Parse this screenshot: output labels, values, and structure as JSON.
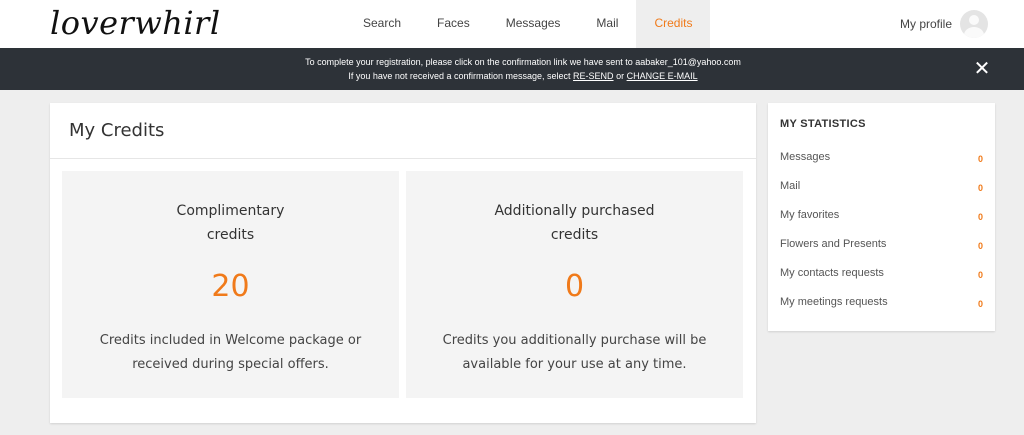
{
  "header": {
    "logo": "loverwhirl",
    "nav": [
      {
        "label": "Search"
      },
      {
        "label": "Faces"
      },
      {
        "label": "Messages"
      },
      {
        "label": "Mail"
      },
      {
        "label": "Credits",
        "active": true
      }
    ],
    "profile_label": "My profile",
    "avatar_icon": "user-avatar-icon"
  },
  "notice": {
    "line1": "To complete your registration, please click on the confirmation link we have sent to aabaker_101@yahoo.com",
    "line2_prefix": "If you have not received a confirmation message, select",
    "resend_link": "RE-SEND",
    "or_text": "or",
    "change_email_link": "CHANGE E-MAIL",
    "close_icon": "close-icon",
    "close_glyph": "✕"
  },
  "credits": {
    "title": "My Credits",
    "complimentary": {
      "heading_line1": "Complimentary",
      "heading_line2": "credits",
      "value": "20",
      "desc_line1": "Credits included in Welcome package or",
      "desc_line2": "received during special offers."
    },
    "purchased": {
      "heading_line1": "Additionally purchased",
      "heading_line2": "credits",
      "value": "0",
      "desc_line1": "Credits you additionally purchase will be",
      "desc_line2": "available for your use at any time."
    }
  },
  "stats": {
    "title": "MY STATISTICS",
    "items": [
      {
        "label": "Messages",
        "count": "0"
      },
      {
        "label": "Mail",
        "count": "0"
      },
      {
        "label": "My favorites",
        "count": "0"
      },
      {
        "label": "Flowers and Presents",
        "count": "0"
      },
      {
        "label": "My contacts requests",
        "count": "0"
      },
      {
        "label": "My meetings requests",
        "count": "0"
      }
    ]
  },
  "colors": {
    "accent": "#f07a1a",
    "notice_bg": "#2d3238",
    "page_bg": "#eeeeee"
  }
}
